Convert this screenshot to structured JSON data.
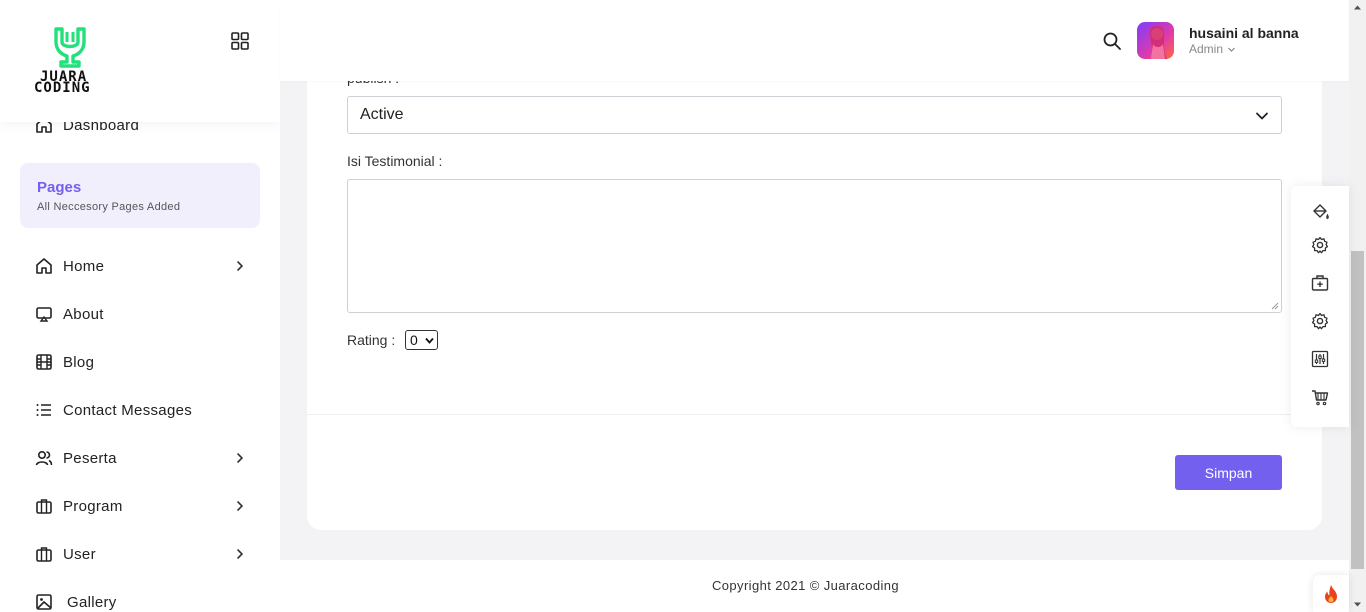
{
  "brand": {
    "logo_line1": "JUARA",
    "logo_line2": "CODING",
    "accent": "#22e07a"
  },
  "sidebar": {
    "dashboard": {
      "label": "Dashboard",
      "icon": "home-icon"
    },
    "pages_card": {
      "title": "Pages",
      "subtitle": "All Neccesory Pages Added"
    },
    "items": [
      {
        "label": "Home",
        "icon": "home-icon",
        "has_submenu": true
      },
      {
        "label": "About",
        "icon": "monitor-icon",
        "has_submenu": false
      },
      {
        "label": "Blog",
        "icon": "film-icon",
        "has_submenu": false
      },
      {
        "label": "Contact Messages",
        "icon": "list-icon",
        "has_submenu": false
      },
      {
        "label": "Peserta",
        "icon": "users-icon",
        "has_submenu": true
      },
      {
        "label": "Program",
        "icon": "briefcase-icon",
        "has_submenu": true
      },
      {
        "label": "User",
        "icon": "briefcase-icon",
        "has_submenu": true
      },
      {
        "label": "Gallery",
        "icon": "image-icon",
        "has_submenu": false
      }
    ]
  },
  "header": {
    "user_name": "husaini al banna",
    "user_role": "Admin"
  },
  "form": {
    "cut_label": "publish :",
    "status_value": "Active",
    "isi_label": "Isi Testimonial :",
    "isi_value": "",
    "rating_label": "Rating :",
    "rating_value": "0",
    "save_label": "Simpan"
  },
  "right_tools": [
    "paint-bucket-icon",
    "settings-icon",
    "add-briefcase-icon",
    "settings-icon",
    "sliders-icon",
    "cart-icon"
  ],
  "footer": {
    "copyright": "Copyright 2021 © Juaracoding"
  },
  "colors": {
    "primary": "#7460ee",
    "pages_bg": "#f1effc",
    "page_bg": "#f3f2f5"
  }
}
